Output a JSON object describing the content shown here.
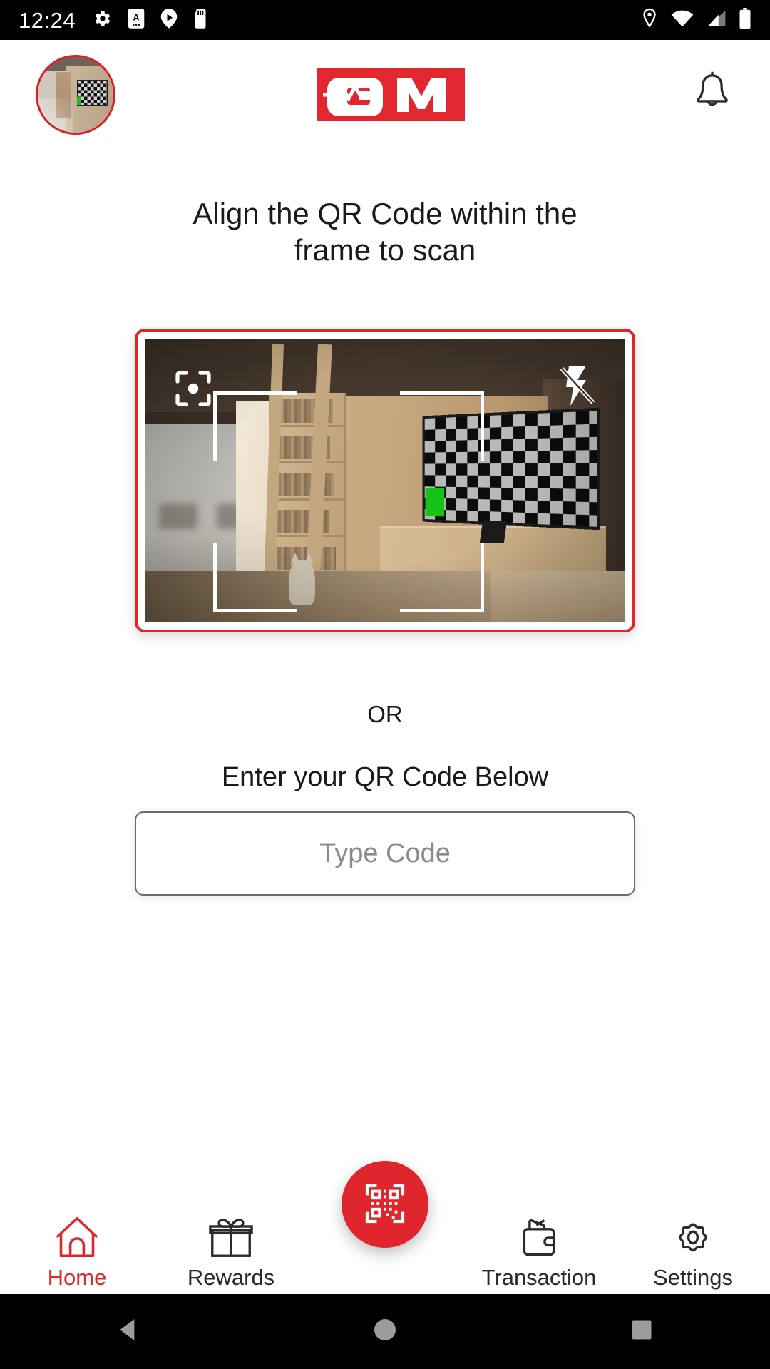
{
  "status_bar": {
    "time": "12:24",
    "left_icons": [
      "gear-icon",
      "app-letter-a-icon",
      "play-store-icon",
      "sd-card-icon"
    ],
    "right_icons": [
      "location-icon",
      "wifi-icon",
      "cellular-signal-icon",
      "battery-icon"
    ]
  },
  "header": {
    "avatar_name": "user-avatar",
    "brand_text": "GM",
    "brand_color": "#e2272e",
    "notification_icon": "bell-icon"
  },
  "main": {
    "headline_line1": "Align the QR Code within the",
    "headline_line2": "frame to scan",
    "scanner": {
      "focus_icon": "center-focus-icon",
      "flash_icon": "flash-off-icon",
      "border_color": "#e0262d"
    },
    "or_text": "OR",
    "enter_label": "Enter your QR Code Below",
    "code_input": {
      "placeholder": "Type Code",
      "value": ""
    }
  },
  "bottom_nav": {
    "active_color": "#e0262d",
    "items": [
      {
        "label": "Home",
        "icon": "home-icon",
        "active": true
      },
      {
        "label": "Rewards",
        "icon": "gift-icon",
        "active": false
      },
      {
        "label": "Transaction",
        "icon": "wallet-icon",
        "active": false
      },
      {
        "label": "Settings",
        "icon": "gear-icon",
        "active": false
      }
    ],
    "fab": {
      "icon": "qr-scan-icon",
      "color": "#e0262d"
    }
  },
  "system_nav": {
    "back": "back-triangle-icon",
    "home": "home-circle-icon",
    "recents": "recents-square-icon"
  }
}
